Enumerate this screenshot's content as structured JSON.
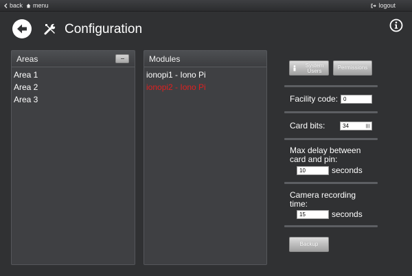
{
  "topbar": {
    "back_label": "back",
    "menu_label": "menu",
    "logout_label": "logout"
  },
  "header": {
    "title": "Configuration"
  },
  "areas": {
    "title": "Areas",
    "remove_label": "−",
    "items": [
      "Area 1",
      "Area 2",
      "Area 3"
    ]
  },
  "modules": {
    "title": "Modules",
    "items": [
      {
        "label": "ionopi1 - Iono Pi",
        "status": "ok"
      },
      {
        "label": "ionopi2 - Iono Pi",
        "status": "error"
      }
    ]
  },
  "buttons": {
    "system_users": "System Users",
    "permissions": "Permissions",
    "backup": "Backup"
  },
  "settings": {
    "facility_code": {
      "label": "Facility code:",
      "value": "0"
    },
    "card_bits": {
      "label": "Card bits:",
      "value": "34"
    },
    "max_delay": {
      "label": "Max delay between card and pin:",
      "value": "10",
      "unit": "seconds"
    },
    "camera_time": {
      "label": "Camera recording time:",
      "value": "15",
      "unit": "seconds"
    }
  },
  "colors": {
    "background": "#303133",
    "panel": "#3f4043",
    "error_text": "#e02020"
  }
}
